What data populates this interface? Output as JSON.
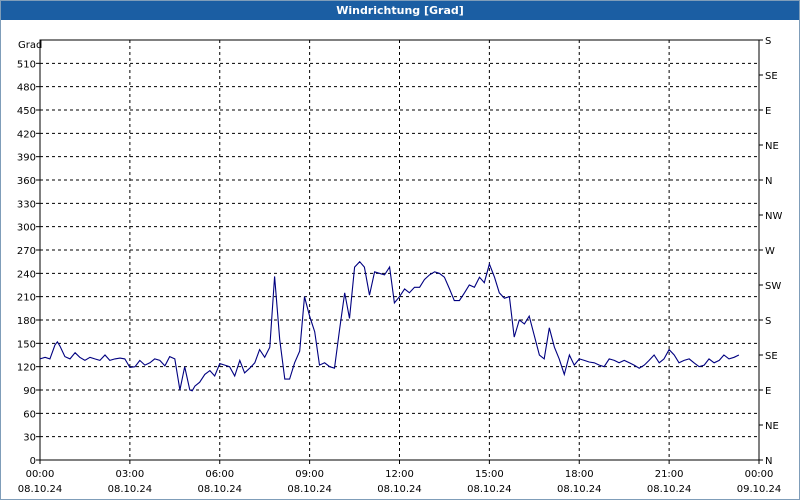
{
  "chart_data": {
    "type": "line",
    "title": "Windrichtung [Grad]",
    "ylabel": "Grad",
    "ylim": [
      0,
      540
    ],
    "y_ticks": [
      0,
      30,
      60,
      90,
      120,
      150,
      180,
      210,
      240,
      270,
      300,
      330,
      360,
      390,
      420,
      450,
      480,
      510
    ],
    "right_axis_labels": [
      "N",
      "NE",
      "E",
      "SE",
      "S",
      "SW",
      "W",
      "NW",
      "N",
      "NE",
      "E",
      "SE",
      "S"
    ],
    "x_ticks": [
      {
        "time": "00:00",
        "date": "08.10.24"
      },
      {
        "time": "03:00",
        "date": "08.10.24"
      },
      {
        "time": "06:00",
        "date": "08.10.24"
      },
      {
        "time": "09:00",
        "date": "08.10.24"
      },
      {
        "time": "12:00",
        "date": "08.10.24"
      },
      {
        "time": "15:00",
        "date": "08.10.24"
      },
      {
        "time": "18:00",
        "date": "08.10.24"
      },
      {
        "time": "21:00",
        "date": "08.10.24"
      },
      {
        "time": "00:00",
        "date": "09.10.24"
      }
    ],
    "xlim_hours": [
      0,
      24
    ],
    "grid": true,
    "line_color": "#000080",
    "series": [
      {
        "x_hours": [
          0.0,
          0.17,
          0.33,
          0.5,
          0.58,
          0.67,
          0.83,
          1.0,
          1.17,
          1.33,
          1.5,
          1.67,
          1.83,
          2.0,
          2.17,
          2.33,
          2.5,
          2.67,
          2.83,
          3.0,
          3.17,
          3.33,
          3.5,
          3.67,
          3.83,
          4.0,
          4.17,
          4.33,
          4.5,
          4.67,
          4.83,
          5.0,
          5.08,
          5.17,
          5.33,
          5.5,
          5.67,
          5.83,
          6.0,
          6.17,
          6.33,
          6.5,
          6.67,
          6.83,
          7.0,
          7.17,
          7.33,
          7.5,
          7.67,
          7.83,
          8.0,
          8.17,
          8.33,
          8.5,
          8.67,
          8.83,
          9.0,
          9.17,
          9.33,
          9.5,
          9.67,
          9.83,
          10.0,
          10.17,
          10.33,
          10.5,
          10.67,
          10.83,
          11.0,
          11.17,
          11.33,
          11.5,
          11.67,
          11.83,
          12.0,
          12.17,
          12.33,
          12.5,
          12.67,
          12.83,
          13.0,
          13.17,
          13.33,
          13.5,
          13.67,
          13.83,
          14.0,
          14.17,
          14.33,
          14.5,
          14.67,
          14.83,
          15.0,
          15.17,
          15.33,
          15.5,
          15.67,
          15.83,
          16.0,
          16.17,
          16.33,
          16.5,
          16.67,
          16.83,
          17.0,
          17.17,
          17.33,
          17.5,
          17.67,
          17.83,
          18.0,
          18.17,
          18.33,
          18.5,
          18.67,
          18.83,
          19.0,
          19.17,
          19.33,
          19.5,
          19.67,
          19.83,
          20.0,
          20.17,
          20.33,
          20.5,
          20.67,
          20.83,
          21.0,
          21.17,
          21.33,
          21.5,
          21.67,
          21.83,
          22.0,
          22.17,
          22.33,
          22.5,
          22.67,
          22.83,
          23.0,
          23.17,
          23.33,
          23.5,
          23.67,
          23.83,
          24.0
        ],
        "y": [
          130,
          132,
          130,
          148,
          152,
          146,
          133,
          130,
          138,
          132,
          128,
          132,
          130,
          128,
          135,
          128,
          130,
          131,
          130,
          119,
          120,
          128,
          122,
          125,
          130,
          128,
          121,
          133,
          130,
          90,
          120,
          90,
          89,
          95,
          100,
          110,
          115,
          108,
          124,
          122,
          120,
          108,
          128,
          112,
          118,
          125,
          142,
          132,
          145,
          236,
          155,
          104,
          104,
          125,
          140,
          210,
          185,
          165,
          122,
          125,
          120,
          118,
          168,
          215,
          182,
          248,
          255,
          248,
          212,
          242,
          240,
          238,
          248,
          202,
          210,
          220,
          215,
          222,
          222,
          232,
          238,
          242,
          240,
          235,
          220,
          205,
          205,
          215,
          225,
          222,
          235,
          228,
          252,
          235,
          215,
          208,
          210,
          158,
          180,
          175,
          185,
          160,
          135,
          130,
          170,
          145,
          130,
          110,
          135,
          122,
          130,
          128,
          126,
          125,
          122,
          120,
          130,
          128,
          125,
          128,
          125,
          122,
          118,
          122,
          128,
          135,
          125,
          130,
          142,
          135,
          125,
          128,
          130,
          125,
          120,
          122,
          130,
          125,
          128,
          135,
          130,
          132,
          135
        ],
        "smoothing_note": null
      }
    ]
  }
}
